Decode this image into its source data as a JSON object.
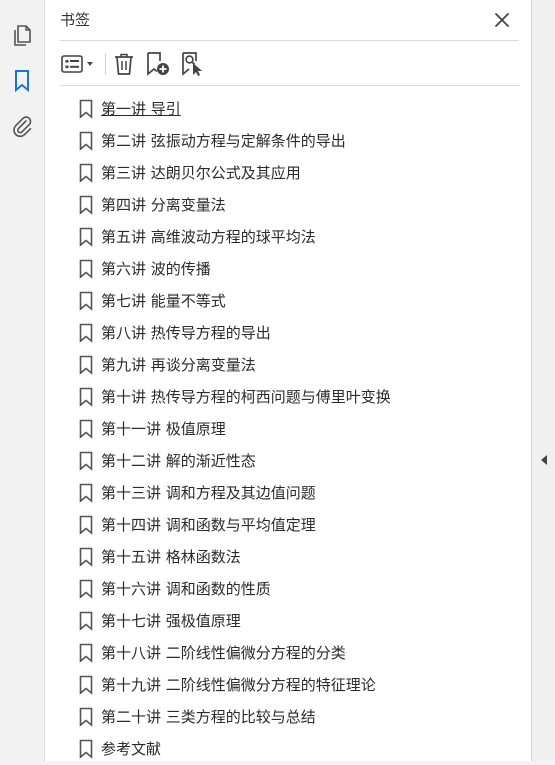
{
  "left_toolbar": {
    "items": [
      {
        "name": "pages-icon",
        "active": false
      },
      {
        "name": "bookmark-icon",
        "active": true
      },
      {
        "name": "attachment-icon",
        "active": false
      }
    ],
    "active_color": "#1473e6"
  },
  "panel": {
    "title": "书签"
  },
  "bookmarks": [
    {
      "label": "第一讲  导引",
      "selected": true
    },
    {
      "label": "第二讲  弦振动方程与定解条件的导出"
    },
    {
      "label": "第三讲  达朗贝尔公式及其应用"
    },
    {
      "label": "第四讲  分离变量法"
    },
    {
      "label": "第五讲  高维波动方程的球平均法"
    },
    {
      "label": "第六讲  波的传播"
    },
    {
      "label": "第七讲  能量不等式"
    },
    {
      "label": "第八讲  热传导方程的导出"
    },
    {
      "label": "第九讲  再谈分离变量法"
    },
    {
      "label": "第十讲  热传导方程的柯西问题与傅里叶变换"
    },
    {
      "label": "第十一讲  极值原理"
    },
    {
      "label": "第十二讲  解的渐近性态"
    },
    {
      "label": "第十三讲  调和方程及其边值问题"
    },
    {
      "label": "第十四讲  调和函数与平均值定理"
    },
    {
      "label": "第十五讲  格林函数法"
    },
    {
      "label": "第十六讲  调和函数的性质"
    },
    {
      "label": "第十七讲  强极值原理"
    },
    {
      "label": "第十八讲  二阶线性偏微分方程的分类"
    },
    {
      "label": "第十九讲  二阶线性偏微分方程的特征理论"
    },
    {
      "label": "第二十讲  三类方程的比较与总结"
    },
    {
      "label": "参考文献"
    }
  ]
}
